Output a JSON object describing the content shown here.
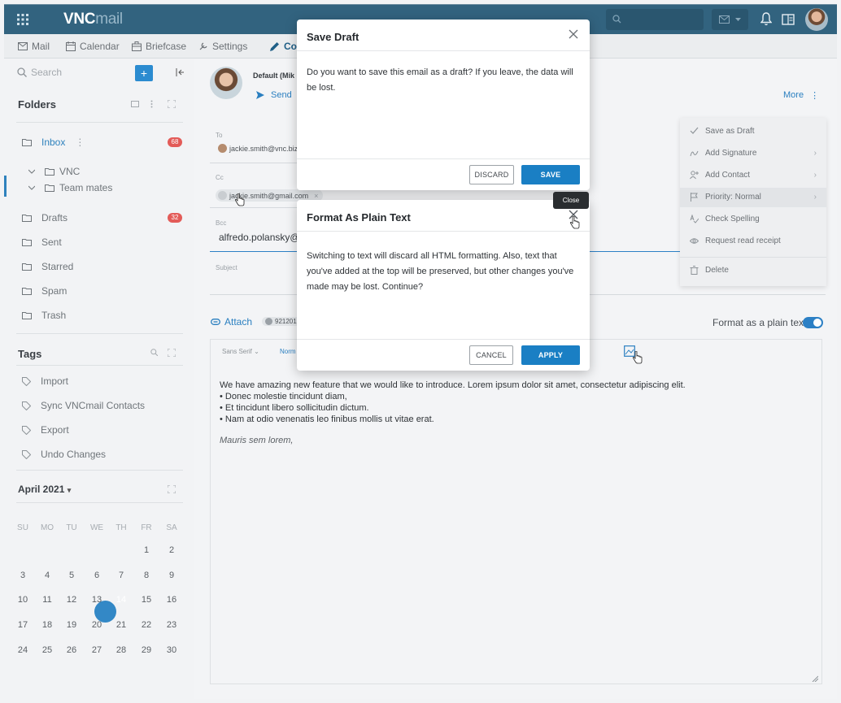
{
  "app": {
    "logo_bold": "VNC",
    "logo_light": "mail"
  },
  "nav": {
    "tabs": [
      {
        "label": "Mail",
        "icon": "mail-icon"
      },
      {
        "label": "Calendar",
        "icon": "calendar-icon"
      },
      {
        "label": "Briefcase",
        "icon": "briefcase-icon"
      },
      {
        "label": "Settings",
        "icon": "settings-icon"
      },
      {
        "label": "Co",
        "icon": "pencil-icon"
      }
    ]
  },
  "sidebar": {
    "search_placeholder": "Search",
    "folders_title": "Folders",
    "folders": [
      {
        "label": "Inbox",
        "badge": "68"
      },
      {
        "label": "VNC"
      },
      {
        "label": "Team mates"
      },
      {
        "label": "Drafts",
        "badge": "32"
      },
      {
        "label": "Sent"
      },
      {
        "label": "Starred"
      },
      {
        "label": "Spam"
      },
      {
        "label": "Trash"
      }
    ],
    "tags_title": "Tags",
    "tags": [
      "Import",
      "Sync VNCmail Contacts",
      "Export",
      "Undo Changes"
    ],
    "calendar": {
      "month": "April 2021",
      "weekdays": [
        "SU",
        "MO",
        "TU",
        "WE",
        "TH",
        "FR",
        "SA"
      ],
      "weeks": [
        [
          "",
          "",
          "",
          "",
          "",
          "1",
          "2"
        ],
        [
          "3",
          "4",
          "5",
          "6",
          "7",
          "8",
          "9"
        ],
        [
          "10",
          "11",
          "12",
          "13",
          "14",
          "15",
          "16"
        ],
        [
          "17",
          "18",
          "19",
          "20",
          "21",
          "22",
          "23"
        ],
        [
          "24",
          "25",
          "26",
          "27",
          "28",
          "29",
          "30"
        ]
      ],
      "today": "14"
    }
  },
  "compose": {
    "from_label": "Default (Mik",
    "send_label": "Send",
    "more_label": "More",
    "to_label": "To",
    "to_chip": "jackie.smith@vnc.biz",
    "cc_label": "Cc",
    "cc_chip": "jackie.smith@gmail.com",
    "bcc_label": "Bcc",
    "bcc_value": "alfredo.polansky@g",
    "subject_label": "Subject",
    "attach_label": "Attach",
    "attachment_chip": "921201",
    "format_plain_label": "Format as a plain text",
    "font_family": "Sans Serif",
    "font_size": "Norm",
    "body_intro": "We have amazing new feature that we would like to introduce. Lorem ipsum dolor sit amet, consectetur adipiscing elit.",
    "body_bullets": [
      "• Donec molestie tincidunt diam,",
      "• Et tincidunt libero sollicitudin dictum.",
      "• Nam at odio venenatis leo finibus mollis ut vitae erat."
    ],
    "signature": "Mauris sem lorem,"
  },
  "more_menu": [
    {
      "label": "Save as Draft",
      "icon": "check-icon"
    },
    {
      "label": "Add Signature",
      "icon": "signature-icon",
      "submenu": true
    },
    {
      "label": "Add Contact",
      "icon": "add-contact-icon",
      "submenu": true
    },
    {
      "label": "Priority: Normal",
      "icon": "flag-icon",
      "submenu": true
    },
    {
      "label": "Check Spelling",
      "icon": "spellcheck-icon"
    },
    {
      "label": "Request read receipt",
      "icon": "eye-icon"
    },
    {
      "label": "Delete",
      "icon": "trash-icon"
    }
  ],
  "save_draft_dialog": {
    "title": "Save Draft",
    "body": "Do you want to save this email as a draft? If you leave, the data will be lost.",
    "discard": "DISCARD",
    "save": "SAVE"
  },
  "plain_text_dialog": {
    "title": "Format As Plain Text",
    "body": "Switching to text will discard all HTML formatting. Also, text that you've added at the top will be preserved, but other changes you've made may be lost. Continue?",
    "cancel": "CANCEL",
    "apply": "APPLY"
  },
  "tooltip": "Close",
  "colors": {
    "topbar": "#32637f",
    "accent": "#1a7fc4",
    "badge": "#e35b58"
  }
}
